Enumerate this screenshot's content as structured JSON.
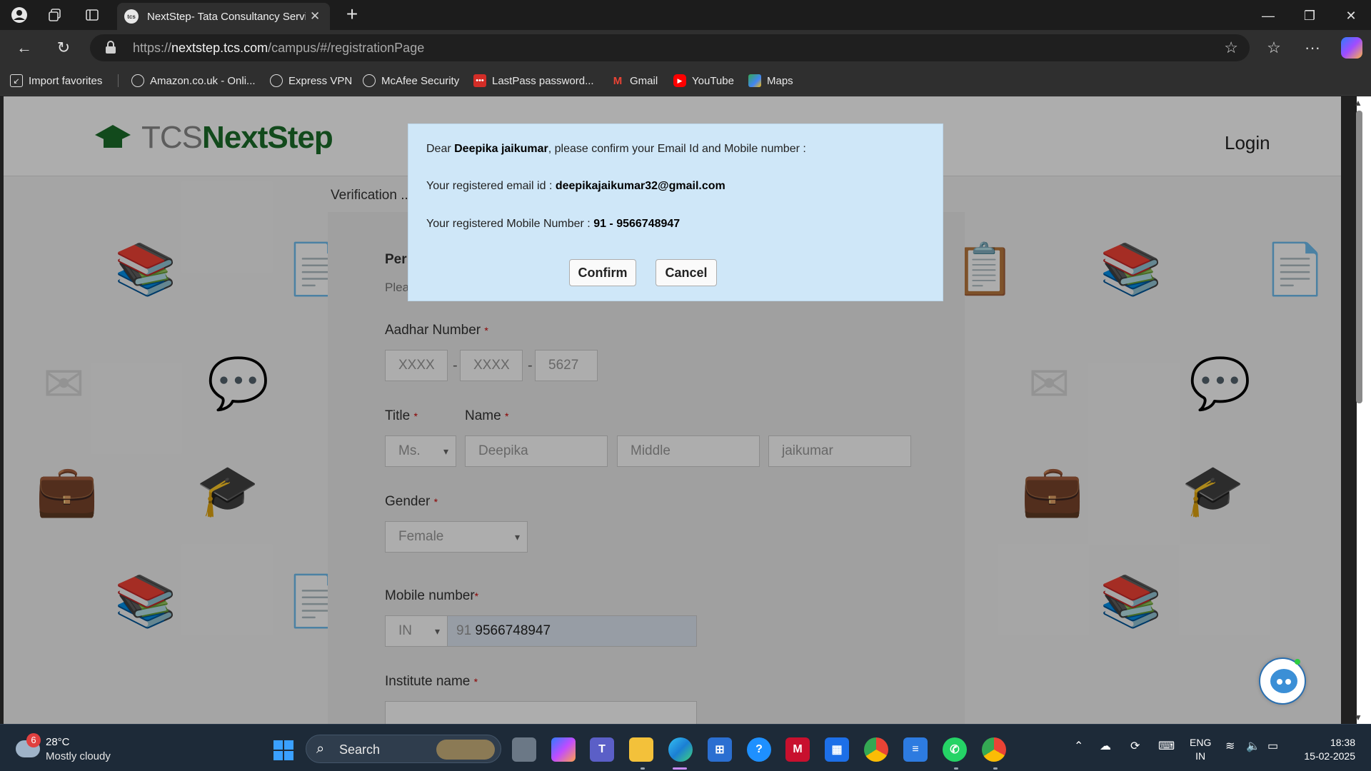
{
  "browser": {
    "tab_title": "NextStep- Tata Consultancy Servic",
    "tab_favicon": "tcs",
    "url_prefix": "https://",
    "url_host": "nextstep.tcs.com",
    "url_path": "/campus/#/registrationPage",
    "favorites": [
      {
        "label": "Import favorites",
        "icon": "import-icon"
      },
      {
        "label": "Amazon.co.uk - Onli...",
        "icon": "globe-icon"
      },
      {
        "label": "Express VPN",
        "icon": "globe-icon"
      },
      {
        "label": "McAfee Security",
        "icon": "globe-icon"
      },
      {
        "label": "LastPass password...",
        "icon": "lastpass-icon"
      },
      {
        "label": "Gmail",
        "icon": "gmail-icon"
      },
      {
        "label": "YouTube",
        "icon": "youtube-icon"
      },
      {
        "label": "Maps",
        "icon": "maps-icon"
      }
    ]
  },
  "site": {
    "logo_light": "TCS",
    "logo_bold": "NextStep",
    "login_label": "Login",
    "verification_label": "Verification ...",
    "section_heading": "Per",
    "section_sub": "Plea"
  },
  "form": {
    "aadhar_label": "Aadhar Number",
    "aadhar_parts": [
      "XXXX",
      "XXXX",
      "5627"
    ],
    "title_label": "Title",
    "title_value": "Ms.",
    "name_label": "Name",
    "first_name": "Deepika",
    "middle_placeholder": "Middle",
    "last_name": "jaikumar",
    "gender_label": "Gender",
    "gender_value": "Female",
    "mobile_label": "Mobile number",
    "country_code": "IN",
    "mobile_prefix": "91",
    "mobile_value": "9566748947",
    "institute_label": "Institute name",
    "required_mark": "*"
  },
  "modal": {
    "greeting_prefix": "Dear ",
    "user_name": "Deepika jaikumar",
    "greeting_suffix": ", please confirm your Email Id and Mobile number :",
    "email_prefix": "Your registered email id : ",
    "email": "deepikajaikumar32@gmail.com",
    "mobile_prefix": "Your registered Mobile Number : ",
    "mobile": "91 - 9566748947",
    "confirm_label": "Confirm",
    "cancel_label": "Cancel"
  },
  "taskbar": {
    "weather_badge": "6",
    "temperature": "28°C",
    "weather_desc": "Mostly cloudy",
    "search_label": "Search",
    "lang_top": "ENG",
    "lang_bottom": "IN",
    "time": "18:38",
    "date": "15-02-2025"
  },
  "colors": {
    "modal_bg": "#cfe7f8",
    "logo_green": "#1b6e2a",
    "required_red": "#cc0000",
    "taskbar_bg": "#1d2a38"
  }
}
